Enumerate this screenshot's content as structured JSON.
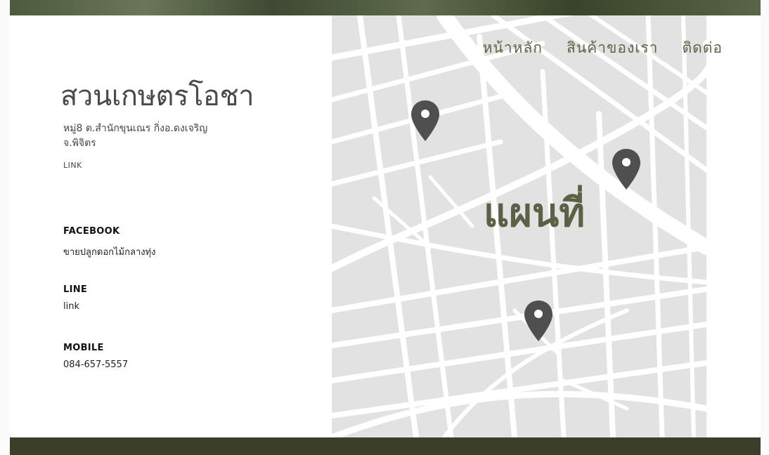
{
  "nav": {
    "home": "หน้าหลัก",
    "products": "สินค้าของเรา",
    "contact": "ติดต่อ"
  },
  "map": {
    "title": "แผนที่",
    "pin_icon": "map-pin-icon",
    "pin_color": "#4f4f4f",
    "street_color": "#ffffff",
    "block_color": "#e2e2e2"
  },
  "brand": {
    "name": "สวนเกษตรโอชา",
    "address_line1": "หมู่8 ต.สำนักขุนเณร กิ่งอ.ดงเจริญ",
    "address_line2": "จ.พิจิตร",
    "link": "LINK"
  },
  "contacts": {
    "facebook_label": "FACEBOOK",
    "facebook_value": "ขายปลูกดอกไม้กลางทุ่ง",
    "line_label": "LINE",
    "line_value": "link",
    "mobile_label": "MOBILE",
    "mobile_value": "084-657-5557"
  },
  "colors": {
    "accent": "#5d6548",
    "footer": "#3b3f29"
  }
}
